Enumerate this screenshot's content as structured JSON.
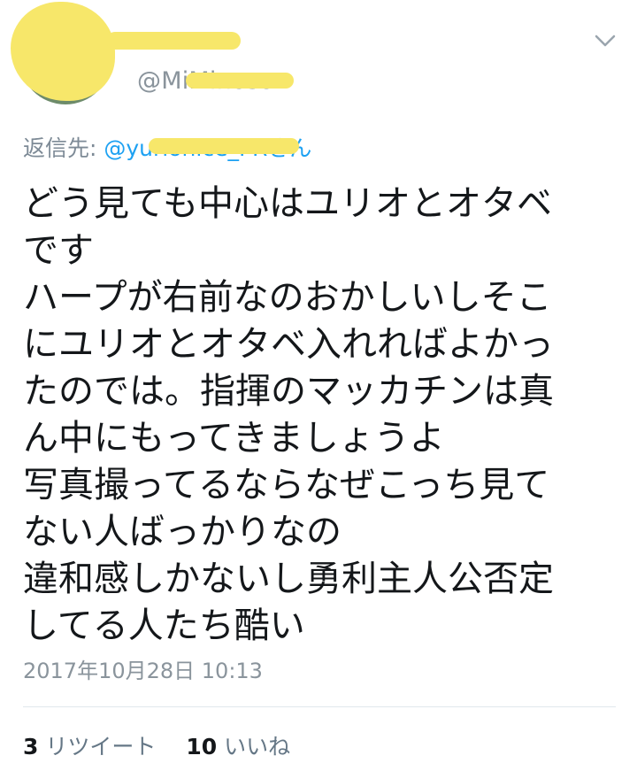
{
  "header": {
    "handle": "@MiMinoso",
    "menu_icon": "chevron-down-icon"
  },
  "reply": {
    "prefix": "返信先: ",
    "mention": "@yurionice_PRさん"
  },
  "tweet": {
    "text": "どう見ても中心はユリオとオタベ\nです\nハープが右前なのおかしいしそこ\nにユリオとオタベ入れればよかっ\nたのでは。指揮のマッカチンは真\nん中にもってきましょうよ\n写真撮ってるならなぜこっち見て\nない人ばっかりなの\n違和感しかないし勇利主人公否定\nしてる人たち酷い"
  },
  "timestamp": "2017年10月28日 10:13",
  "stats": {
    "retweets_count": "3",
    "retweets_label": "リツイート",
    "likes_count": "10",
    "likes_label": "いいね"
  },
  "colors": {
    "redaction": "#f7e76a",
    "link": "#1da1f2",
    "muted": "#8a949c"
  }
}
